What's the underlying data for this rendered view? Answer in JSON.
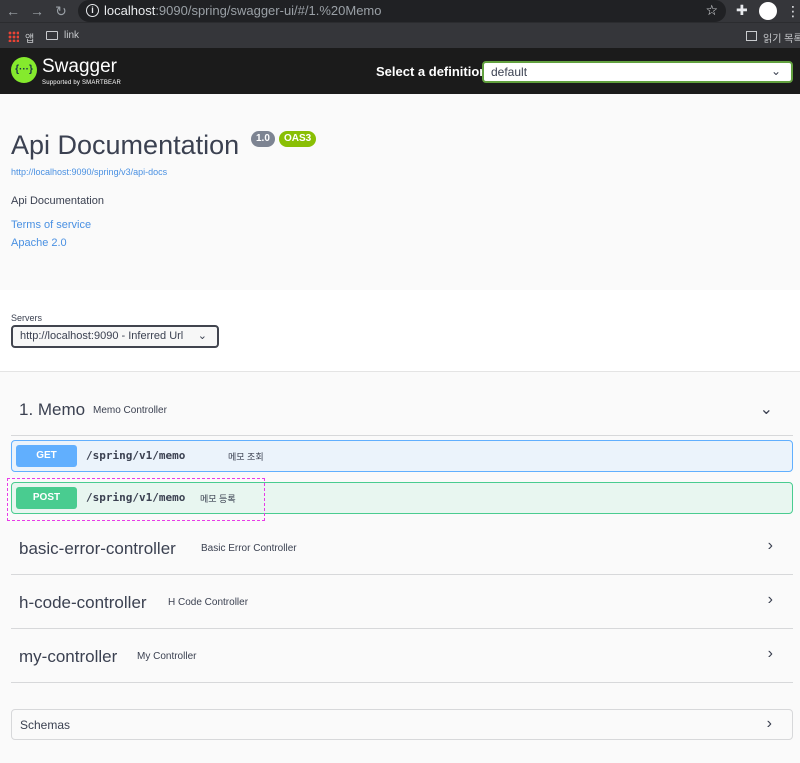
{
  "browser": {
    "url_host": "localhost",
    "url_rest": ":9090/spring/swagger-ui/#/1.%20Memo",
    "bookmarks": [
      {
        "label": "앱"
      },
      {
        "label": "link"
      }
    ],
    "reading_list_label": "읽기 목록"
  },
  "topbar": {
    "logo_mark": "{···}",
    "logo_text": "Swagger",
    "logo_sub": "Supported by SMARTBEAR",
    "definition_label": "Select a definition",
    "definition_value": "default"
  },
  "info": {
    "title": "Api Documentation",
    "version": "1.0",
    "oas": "OAS3",
    "doc_url": "http://localhost:9090/spring/v3/api-docs",
    "description": "Api Documentation",
    "terms": "Terms of service",
    "license": "Apache 2.0"
  },
  "servers": {
    "label": "Servers",
    "selected": "http://localhost:9090 - Inferred Url"
  },
  "tags": [
    {
      "name": "1. Memo",
      "description": "Memo Controller",
      "expanded": true
    },
    {
      "name": "basic-error-controller",
      "description": "Basic Error Controller",
      "expanded": false
    },
    {
      "name": "h-code-controller",
      "description": "H Code Controller",
      "expanded": false
    },
    {
      "name": "my-controller",
      "description": "My Controller",
      "expanded": false
    }
  ],
  "operations": [
    {
      "method": "GET",
      "path": "/spring/v1/memo",
      "summary": "메모 조회",
      "color": "#61affe"
    },
    {
      "method": "POST",
      "path": "/spring/v1/memo",
      "summary": "메모 등록",
      "color": "#49cc90"
    }
  ],
  "schemas": {
    "label": "Schemas"
  },
  "colors": {
    "accent": "#85ea2d",
    "highlight": "#e83be8"
  }
}
